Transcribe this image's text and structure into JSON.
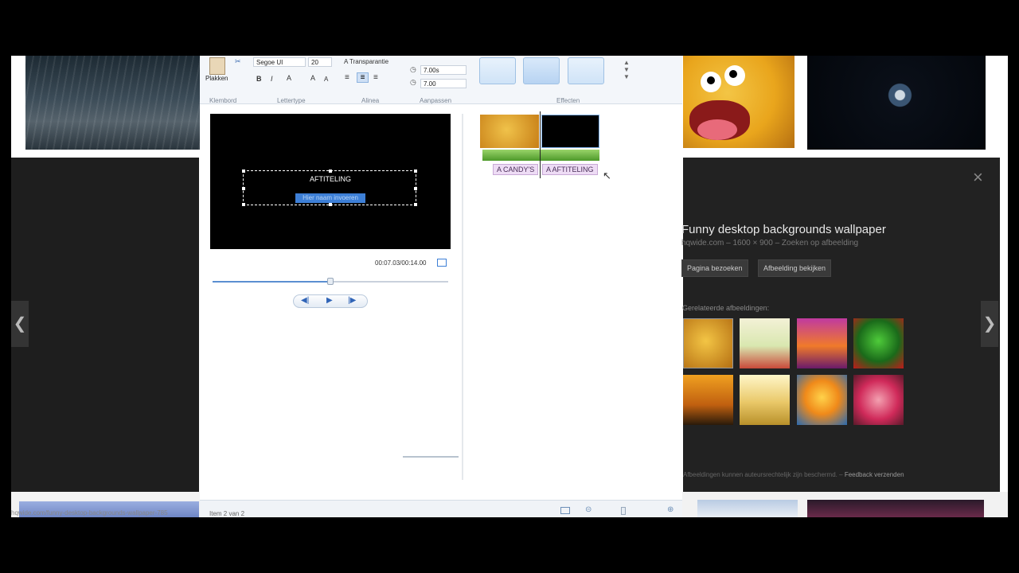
{
  "ribbon": {
    "clipboard_label": "Plakken",
    "clipboard_group": "Klembord",
    "font_name": "Segoe UI",
    "font_size": "20",
    "font_group": "Lettertype",
    "transparency_label": "Transparantie",
    "paragraph_group": "Alinea",
    "duration_value": "7.00s",
    "start_value": "7.00",
    "adjust_group": "Aanpassen",
    "effects_group": "Effecten"
  },
  "preview": {
    "title_text": "AFTITELING",
    "name_placeholder": "Hier naam invoeren",
    "timecode": "00:07.03/00:14.00"
  },
  "storyboard": {
    "captions": [
      "CANDY'S",
      "AFTITELING"
    ]
  },
  "status": {
    "item_text": "Item 2 van 2"
  },
  "image_panel": {
    "title": "Funny desktop backgrounds wallpaper",
    "meta": "hqwide.com – 1600 × 900 – Zoeken op afbeelding",
    "visit_button": "Pagina bezoeken",
    "view_button": "Afbeelding bekijken",
    "related_label": "Gerelateerde afbeeldingen:",
    "footer_note": "Afbeeldingen kunnen auteursrechtelijk zijn beschermd.",
    "feedback_link": "Feedback verzenden"
  },
  "browser": {
    "url_text": "hqwide.com/funny-desktop-backgrounds-wallpaper-785"
  },
  "colors": {
    "accent": "#3d7fd6",
    "panel_bg": "#222222"
  }
}
